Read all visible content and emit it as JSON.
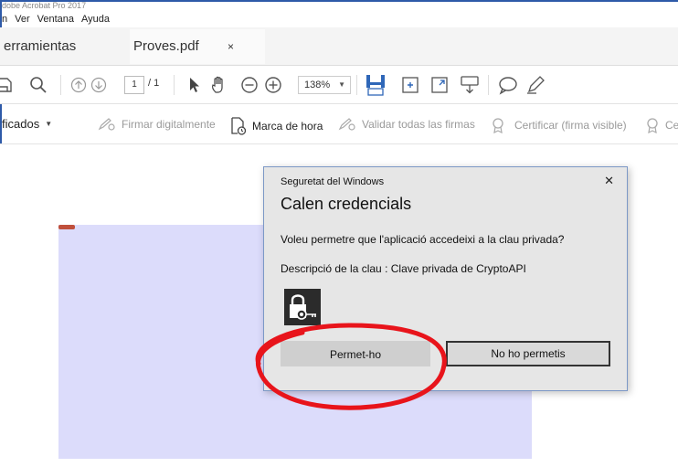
{
  "window": {
    "title": "dobe Acrobat Pro 2017"
  },
  "menu": {
    "items": [
      "n",
      "Ver",
      "Ventana",
      "Ayuda"
    ]
  },
  "tabs": {
    "tools_label": "erramientas",
    "doc_label": "Proves.pdf",
    "close_glyph": "×"
  },
  "toolbar": {
    "page_current": "1",
    "page_total": "/ 1",
    "zoom": "138%",
    "icons": [
      "save-icon",
      "search-icon",
      "page-up-icon",
      "page-down-icon",
      "select-arrow-icon",
      "hand-icon",
      "zoom-out-icon",
      "zoom-in-icon",
      "fit-page-icon",
      "scroll-mode-icon",
      "full-screen-icon",
      "read-mode-icon",
      "comment-icon",
      "pen-icon"
    ]
  },
  "signature_bar": {
    "certified_label": "ficados",
    "items": [
      {
        "label": "Firmar digitalmente",
        "enabled": false
      },
      {
        "label": "Marca de hora",
        "enabled": true
      },
      {
        "label": "Validar todas las firmas",
        "enabled": false
      },
      {
        "label": "Certificar (firma visible)",
        "enabled": false
      },
      {
        "label": "Ce",
        "enabled": false
      }
    ]
  },
  "dialog": {
    "title": "Seguretat del Windows",
    "close_glyph": "✕",
    "heading": "Calen credencials",
    "question": "Voleu permetre que l'aplicació accedeixi a la clau privada?",
    "desc_label": "Descripció de la clau",
    "desc_value": ": Clave privada de CryptoAPI",
    "allow_button": "Permet-ho",
    "deny_button": "No ho permetis"
  },
  "colors": {
    "window_border": "#2e5aa8",
    "page_fill": "#dcdcfb",
    "highlight_ellipse": "#e8141b"
  }
}
